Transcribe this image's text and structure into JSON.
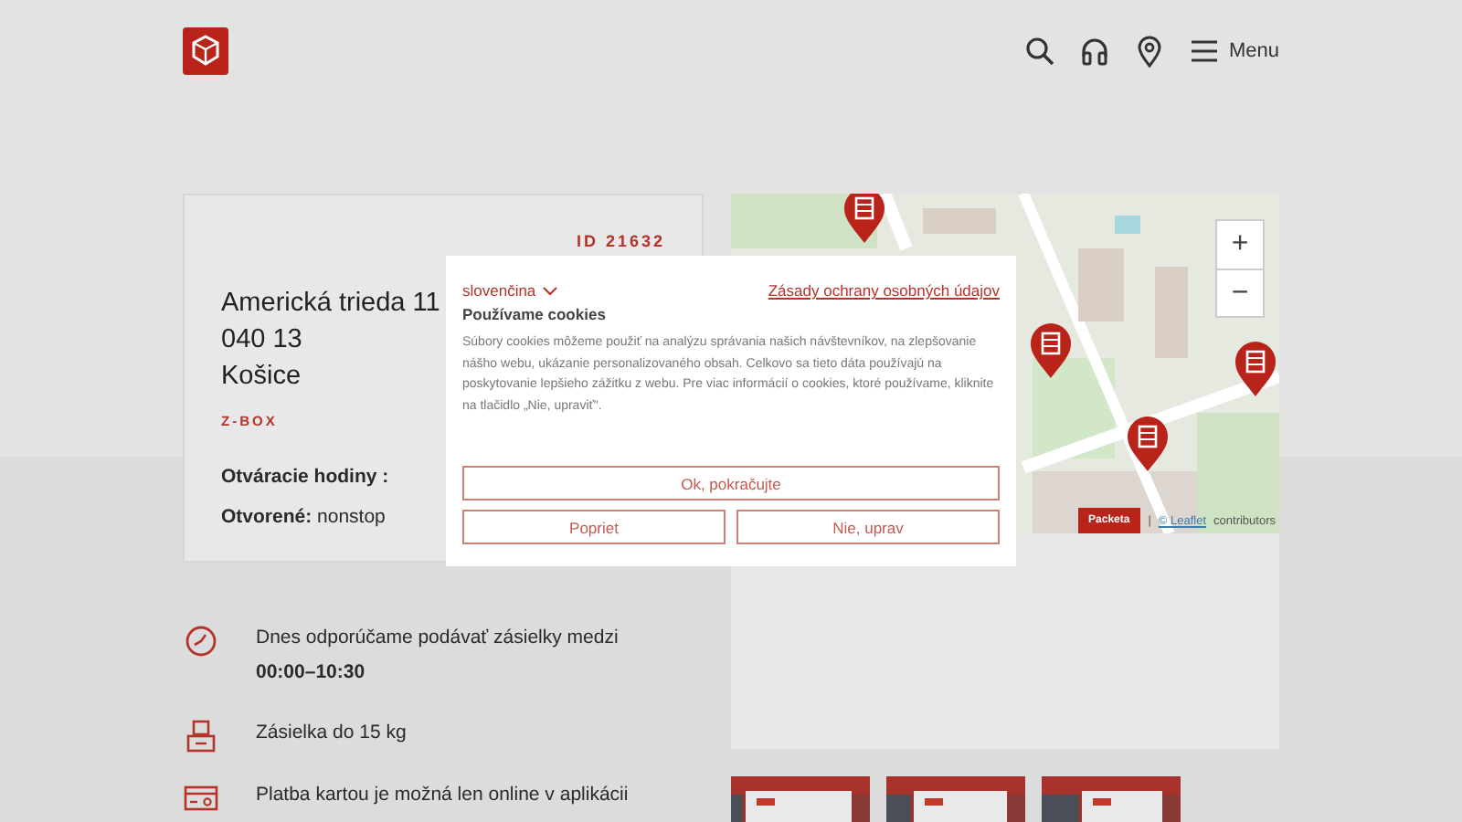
{
  "header": {
    "menu_label": "Menu"
  },
  "place": {
    "id": "ID 21632",
    "address": [
      "Americká trieda 11",
      "040 13",
      "Košice"
    ],
    "type": "Z-BOX",
    "hours_label": "Otváracie hodiny :",
    "open_label": "Otvorené:",
    "open_value": "nonstop"
  },
  "features": [
    {
      "kind": "clock",
      "text": "Dnes odporúčame podávať zásielky medzi **00:00–10:30**"
    },
    {
      "kind": "parcel",
      "text": "Zásielka do 15 kg"
    },
    {
      "kind": "card",
      "text": "Platba kartou je možná len online v aplikácii"
    }
  ],
  "map": {
    "zoom_in": "+",
    "zoom_out": "−",
    "badge": "Packeta",
    "separator": "|",
    "attribution_link": "© Leaflet",
    "attribution": "contributors"
  },
  "cookie_dialog": {
    "language": "slovenčina",
    "privacy_link": "Zásady ochrany osobných údajov",
    "title": "Používame cookies",
    "body": "Súbory cookies môžeme použiť na analýzu správania našich návštevníkov, na zlepšovanie nášho webu, ukázanie personalizovaného obsah. Celkovo sa tieto dáta používajú na poskytovanie lepšieho zážitku z webu. Pre viac informácií o cookies, ktoré používame, kliknite na tlačidlo „Nie, upraviť\".",
    "buttons": [
      {
        "kind": "accept",
        "label": "Ok, pokračujte"
      },
      {
        "kind": "reject",
        "label": "Popriet"
      },
      {
        "kind": "customize",
        "label": "Nie, uprav"
      }
    ]
  }
}
